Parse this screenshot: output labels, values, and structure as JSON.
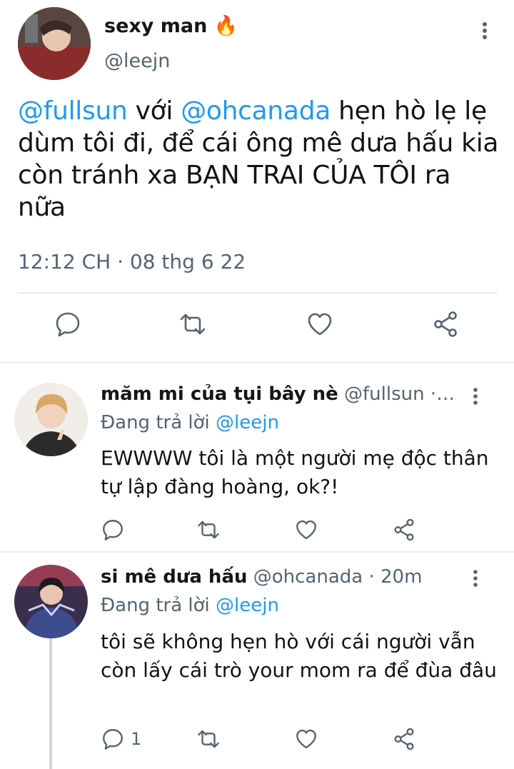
{
  "main_tweet": {
    "name": "sexy man 🔥",
    "handle": "@leejn",
    "text_parts": {
      "mention1": "@fullsun",
      "t1": " với ",
      "mention2": "@ohcanada",
      "t2": " hẹn hò lẹ lẹ dùm tôi đi, để cái ông mê dưa hấu kia còn tránh xa BẠN TRAI CỦA TÔI ra nữa"
    },
    "timestamp": "12:12 CH · 08 thg 6 22",
    "icons": [
      "reply-icon",
      "retweet-icon",
      "like-icon",
      "share-icon",
      "more-icon"
    ]
  },
  "replies": [
    {
      "name": "măm mi của tụi bây nè",
      "meta": " @fullsun ·…",
      "replying_prefix": "Đang trả lời ",
      "replying_to": "@leejn",
      "text": "EWWWW tôi là một người mẹ độc thân tự lập đàng hoàng, ok?!",
      "reply_count": ""
    },
    {
      "name": "si mê dưa hấu",
      "meta": " @ohcanada · 20m",
      "replying_prefix": "Đang trả lời ",
      "replying_to": "@leejn",
      "text": "tôi sẽ không hẹn hò với cái người vẫn còn lấy cái trò your mom ra để đùa đâu",
      "reply_count": "1"
    }
  ],
  "colors": {
    "accent": "#1d9bf0",
    "secondary_text": "#536471",
    "divider": "#cfd9de"
  }
}
